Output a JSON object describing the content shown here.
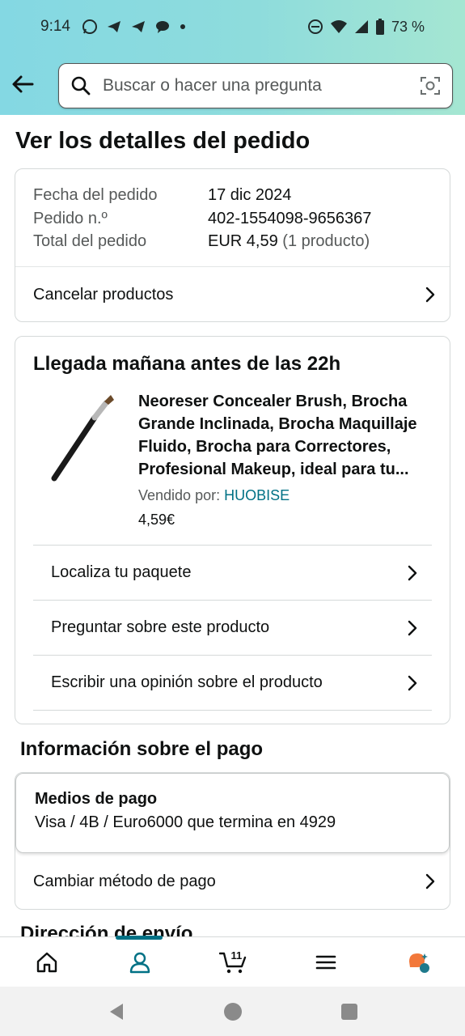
{
  "status_bar": {
    "time": "9:14",
    "battery": "73 %"
  },
  "search": {
    "placeholder": "Buscar o hacer una pregunta"
  },
  "page": {
    "title": "Ver los detalles del pedido"
  },
  "order_summary": {
    "rows": [
      {
        "label": "Fecha del pedido",
        "value": "17 dic 2024",
        "extra": ""
      },
      {
        "label": "Pedido n.º",
        "value": "402-1554098-9656367",
        "extra": ""
      },
      {
        "label": "Total del pedido",
        "value": "EUR 4,59",
        "extra": "(1 producto)"
      }
    ],
    "cancel_label": "Cancelar productos"
  },
  "shipment": {
    "arrival": "Llegada mañana antes de las 22h",
    "product_title": "Neoreser Concealer Brush, Brocha Grande Inclinada, Brocha Maquillaje Fluido, Brocha para Correctores, Profesional Makeup, ideal para tu...",
    "sold_by_label": "Vendido por:",
    "seller": "HUOBISE",
    "price": "4,59€",
    "actions": [
      "Localiza tu paquete",
      "Preguntar sobre este producto",
      "Escribir una opinión sobre el producto"
    ]
  },
  "payment": {
    "section_title": "Información sobre el pago",
    "methods_heading": "Medios de pago",
    "card_line": "Visa / 4B / Euro6000  que termina en 4929",
    "change_label": "Cambiar método de pago"
  },
  "next_section_title": "Dirección de envío",
  "bottom_nav": {
    "items": [
      "home-icon",
      "account-icon",
      "cart-icon",
      "menu-icon",
      "rufus-icon"
    ],
    "cart_count": "11",
    "active": "account-icon",
    "accent": "#007185"
  }
}
